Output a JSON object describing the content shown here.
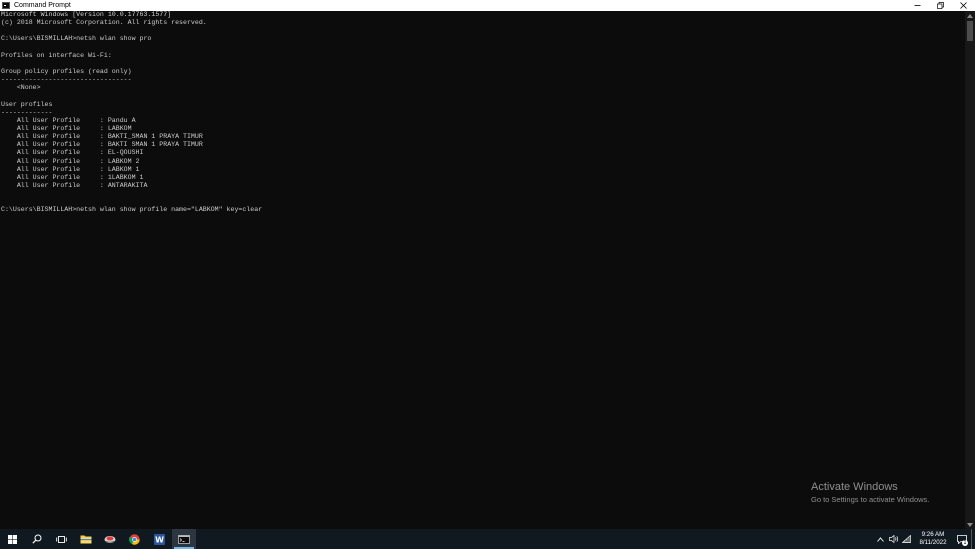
{
  "window": {
    "title": "Command Prompt",
    "icon": "cmd-icon"
  },
  "console": {
    "lines": [
      "Microsoft Windows [Version 10.0.17763.1577]",
      "(c) 2018 Microsoft Corporation. All rights reserved.",
      "",
      "C:\\Users\\BISMILLAH>netsh wlan show pro",
      "",
      "Profiles on interface Wi-Fi:",
      "",
      "Group policy profiles (read only)",
      "---------------------------------",
      "    <None>",
      "",
      "User profiles",
      "-------------",
      "    All User Profile     : Pandu A",
      "    All User Profile     : LABKOM",
      "    All User Profile     : BAKTI_SMAN 1 PRAYA TIMUR",
      "    All User Profile     : BAKTI SMAN 1 PRAYA TIMUR",
      "    All User Profile     : EL-QOUSHI",
      "    All User Profile     : LABKOM 2",
      "    All User Profile     : LABKOM 1",
      "    All User Profile     : 1LABKOM 1",
      "    All User Profile     : ANTARAKITA",
      "",
      "",
      "C:\\Users\\BISMILLAH>netsh wlan show profile name=\"LABKOM\" key=clear"
    ]
  },
  "watermark": {
    "title": "Activate Windows",
    "subtitle": "Go to Settings to activate Windows."
  },
  "taskbar": {
    "items": [
      {
        "name": "start-button",
        "icon": "windows-logo-icon"
      },
      {
        "name": "search-button",
        "icon": "search-icon"
      },
      {
        "name": "task-view-button",
        "icon": "task-view-icon"
      },
      {
        "name": "file-explorer-button",
        "icon": "folder-icon"
      },
      {
        "name": "app-button",
        "icon": "app-icon"
      },
      {
        "name": "chrome-button",
        "icon": "chrome-icon"
      },
      {
        "name": "word-button",
        "icon": "word-icon"
      },
      {
        "name": "command-prompt-taskbar-button",
        "icon": "cmd-icon",
        "active": true
      }
    ],
    "clock": {
      "time": "9:26 AM",
      "date": "8/11/2022"
    },
    "notification_count": "1"
  },
  "colors": {
    "console_bg": "#0c0c0c",
    "console_fg": "#cccccc",
    "taskbar_bg": "#101820",
    "accent": "#76b9ed"
  }
}
